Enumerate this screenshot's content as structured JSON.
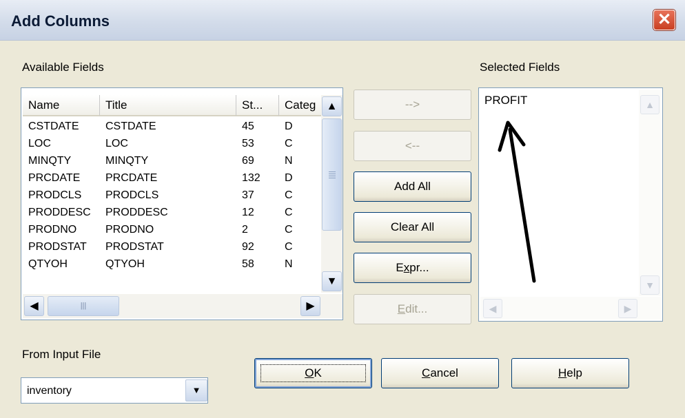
{
  "window": {
    "title": "Add Columns",
    "close_symbol": "✕"
  },
  "available_fields": {
    "label": "Available Fields",
    "columns": [
      "Name",
      "Title",
      "St...",
      "Categ"
    ],
    "rows": [
      [
        "CSTDATE",
        "CSTDATE",
        "45",
        "D"
      ],
      [
        "LOC",
        "LOC",
        "53",
        "C"
      ],
      [
        "MINQTY",
        "MINQTY",
        "69",
        "N"
      ],
      [
        "PRCDATE",
        "PRCDATE",
        "132",
        "D"
      ],
      [
        "PRODCLS",
        "PRODCLS",
        "37",
        "C"
      ],
      [
        "PRODDESC",
        "PRODDESC",
        "12",
        "C"
      ],
      [
        "PRODNO",
        "PRODNO",
        "2",
        "C"
      ],
      [
        "PRODSTAT",
        "PRODSTAT",
        "92",
        "C"
      ],
      [
        "QTYOH",
        "QTYOH",
        "58",
        "N"
      ]
    ]
  },
  "selected_fields": {
    "label": "Selected Fields",
    "items": [
      "PROFIT"
    ]
  },
  "buttons": {
    "add": "-->",
    "remove": "<--",
    "add_all": "Add All",
    "clear_all": "Clear All",
    "expr_pre": "E",
    "expr_ul": "x",
    "expr_post": "pr...",
    "edit_ul": "E",
    "edit_post": "dit...",
    "ok_ul": "O",
    "ok_post": "K",
    "cancel_ul": "C",
    "cancel_post": "ancel",
    "help_ul": "H",
    "help_post": "elp"
  },
  "input_file": {
    "label": "From Input File",
    "value": "inventory"
  },
  "icons": [
    "close-icon",
    "arrow-up-icon",
    "arrow-down-icon",
    "arrow-left-icon",
    "arrow-right-icon",
    "dropdown-arrow-icon",
    "annotation-arrow"
  ],
  "colors": {
    "dialog_bg": "#ece9d8",
    "border": "#7f9db9",
    "close_red": "#c93f22",
    "disabled_text": "#a6a393"
  }
}
